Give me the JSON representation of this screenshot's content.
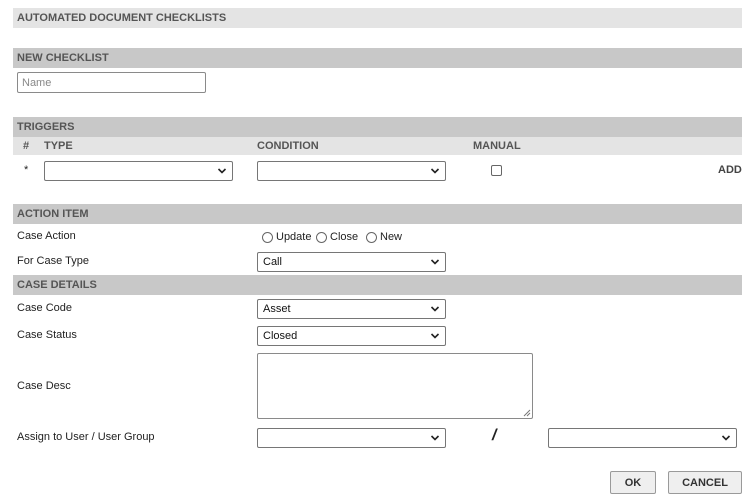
{
  "page_title": "AUTOMATED DOCUMENT CHECKLISTS",
  "new_checklist": {
    "header": "NEW CHECKLIST",
    "name_placeholder": "Name",
    "name_value": ""
  },
  "triggers": {
    "header": "TRIGGERS",
    "columns": {
      "num": "#",
      "type": "TYPE",
      "condition": "CONDITION",
      "manual": "MANUAL"
    },
    "row_marker": "*",
    "type_value": "",
    "condition_value": "",
    "add_label": "ADD"
  },
  "action_item": {
    "header": "ACTION ITEM",
    "case_action_label": "Case Action",
    "options": [
      "Update",
      "Close",
      "New"
    ],
    "case_type_label": "For Case Type",
    "case_type_value": "Call"
  },
  "case_details": {
    "header": "CASE DETAILS",
    "case_code_label": "Case Code",
    "case_code_value": "Asset",
    "case_status_label": "Case Status",
    "case_status_value": "Closed",
    "case_desc_label": "Case Desc",
    "assign_label": "Assign to User / User Group",
    "user_value": "",
    "separator": "/",
    "group_value": ""
  },
  "buttons": {
    "ok": "OK",
    "cancel": "CANCEL"
  },
  "icons": {
    "dropdown": "chevron-down-icon",
    "resize": "resize-grip-icon"
  }
}
